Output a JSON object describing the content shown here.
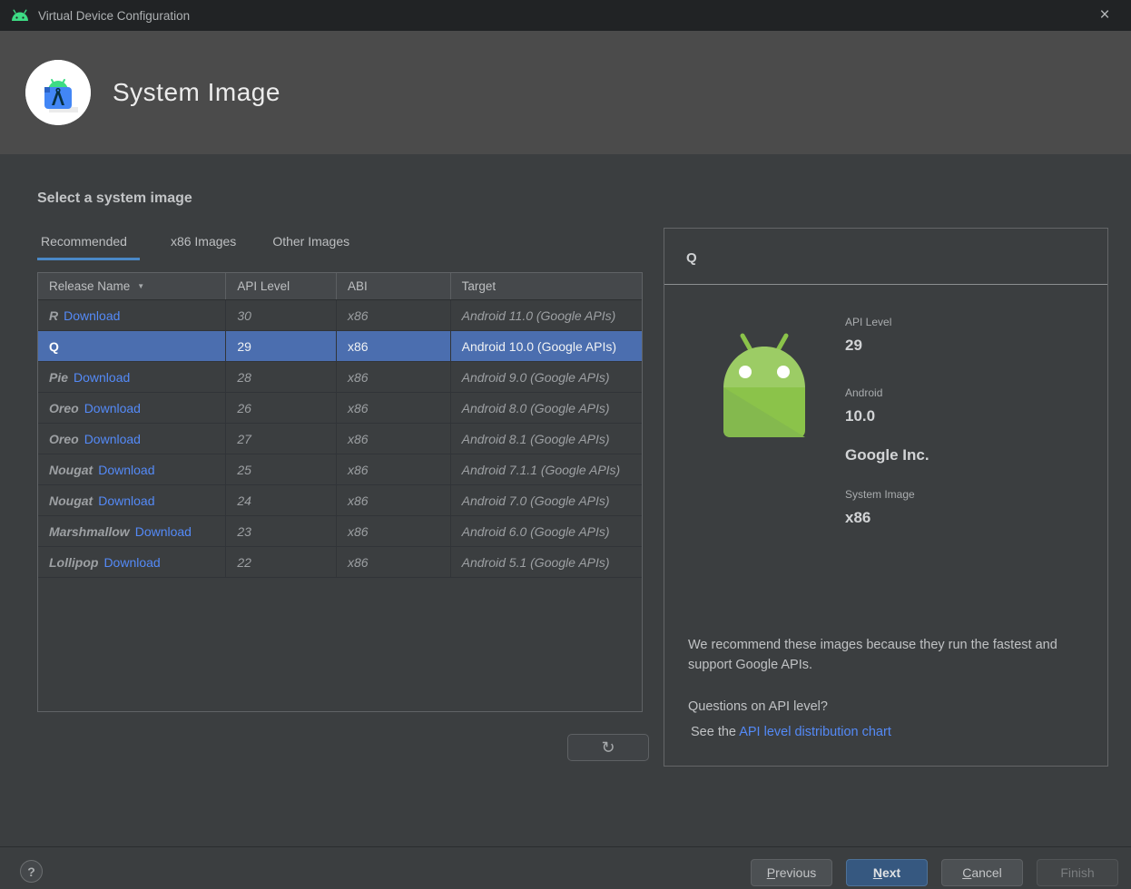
{
  "window": {
    "title": "Virtual Device Configuration"
  },
  "icons": {
    "close": "×",
    "help": "?",
    "sort_desc": "▼",
    "refresh": "↻"
  },
  "header": {
    "title": "System Image"
  },
  "main": {
    "heading": "Select a system image",
    "tabs": [
      {
        "label": "Recommended"
      },
      {
        "label": "x86 Images"
      },
      {
        "label": "Other Images"
      }
    ],
    "table": {
      "columns": [
        "Release Name",
        "API Level",
        "ABI",
        "Target"
      ],
      "rows": [
        {
          "name": "R",
          "download": "Download",
          "api": "30",
          "abi": "x86",
          "target": "Android 11.0 (Google APIs)"
        },
        {
          "name": "Q",
          "download": "",
          "api": "29",
          "abi": "x86",
          "target": "Android 10.0 (Google APIs)"
        },
        {
          "name": "Pie",
          "download": "Download",
          "api": "28",
          "abi": "x86",
          "target": "Android 9.0 (Google APIs)"
        },
        {
          "name": "Oreo",
          "download": "Download",
          "api": "26",
          "abi": "x86",
          "target": "Android 8.0 (Google APIs)"
        },
        {
          "name": "Oreo",
          "download": "Download",
          "api": "27",
          "abi": "x86",
          "target": "Android 8.1 (Google APIs)"
        },
        {
          "name": "Nougat",
          "download": "Download",
          "api": "25",
          "abi": "x86",
          "target": "Android 7.1.1 (Google APIs)"
        },
        {
          "name": "Nougat",
          "download": "Download",
          "api": "24",
          "abi": "x86",
          "target": "Android 7.0 (Google APIs)"
        },
        {
          "name": "Marshmallow",
          "download": "Download",
          "api": "23",
          "abi": "x86",
          "target": "Android 6.0 (Google APIs)"
        },
        {
          "name": "Lollipop",
          "download": "Download",
          "api": "22",
          "abi": "x86",
          "target": "Android 5.1 (Google APIs)"
        }
      ]
    }
  },
  "details": {
    "title": "Q",
    "api_label": "API Level",
    "api_value": "29",
    "android_label": "Android",
    "android_value": "10.0",
    "vendor": "Google Inc.",
    "system_image_label": "System Image",
    "system_image_value": "x86",
    "recommendation": "We recommend these images because they run the fastest and support Google APIs.",
    "question": "Questions on API level?",
    "see_prefix": "See the ",
    "link": "API level distribution chart"
  },
  "colors": {
    "accent": "#4a88c7",
    "selection": "#4b6eaf",
    "link": "#548af7",
    "android_green": "#3ddc84",
    "next_button": "#365880"
  },
  "footer": {
    "buttons": [
      {
        "first": "P",
        "rest": "revious"
      },
      {
        "first": "N",
        "rest": "ext"
      },
      {
        "first": "C",
        "rest": "ancel"
      },
      {
        "first": "",
        "rest": "Finish"
      }
    ]
  }
}
